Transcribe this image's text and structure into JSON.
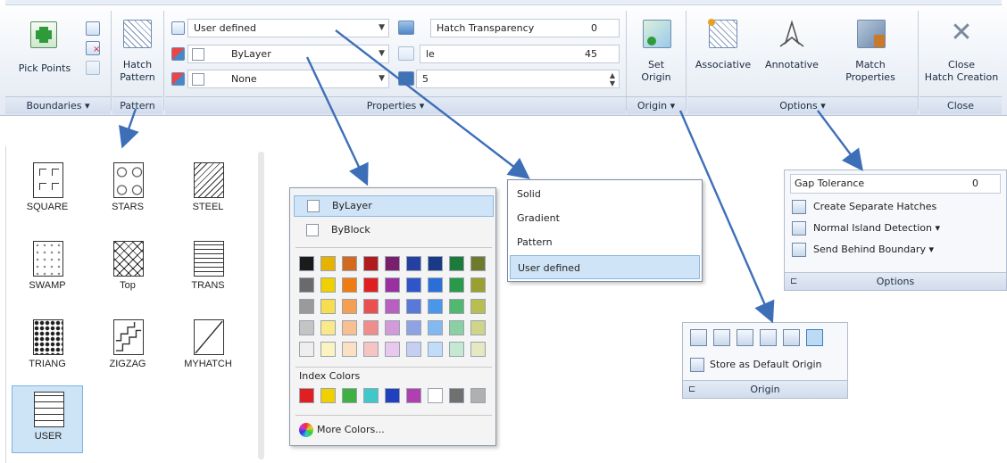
{
  "ribbon": {
    "boundaries": {
      "pick_points": "Pick Points",
      "panel_label": "Boundaries"
    },
    "pattern": {
      "button_line1": "Hatch",
      "button_line2": "Pattern",
      "panel_label": "Pattern"
    },
    "properties": {
      "hatch_type": "User defined",
      "color": "ByLayer",
      "background": "None",
      "transparency_label": "Hatch Transparency",
      "transparency_value": "0",
      "angle_label": "le",
      "angle_value": "45",
      "scale_value": "5",
      "panel_label": "Properties"
    },
    "origin": {
      "set_origin_line1": "Set",
      "set_origin_line2": "Origin",
      "panel_label": "Origin"
    },
    "options": {
      "associative": "Associative",
      "annotative": "Annotative",
      "match_line1": "Match",
      "match_line2": "Properties",
      "panel_label": "Options"
    },
    "close": {
      "line1": "Close",
      "line2": "Hatch Creation",
      "panel_label": "Close"
    }
  },
  "patterns": [
    {
      "name": "SQUARE"
    },
    {
      "name": "STARS"
    },
    {
      "name": "STEEL"
    },
    {
      "name": "SWAMP"
    },
    {
      "name": "Top"
    },
    {
      "name": "TRANS"
    },
    {
      "name": "TRIANG"
    },
    {
      "name": "ZIGZAG"
    },
    {
      "name": "MYHATCH"
    },
    {
      "name": "USER"
    }
  ],
  "color_menu": {
    "bylayer": "ByLayer",
    "byblock": "ByBlock",
    "index_colors_label": "Index Colors",
    "more_colors": "More Colors...",
    "grid_rows": [
      [
        "#1b1b1b",
        "#e6b400",
        "#d2691e",
        "#b01c1c",
        "#7a1f6b",
        "#2440a0",
        "#1a3a86",
        "#1e7a3a",
        "#707a2c"
      ],
      [
        "#6a6a6a",
        "#f0d000",
        "#ef7c10",
        "#e02020",
        "#9a2fa0",
        "#2f55c8",
        "#2a6ed8",
        "#2a9a4a",
        "#9aa030"
      ],
      [
        "#9a9a9a",
        "#f6de50",
        "#f4a050",
        "#ea5050",
        "#b860c0",
        "#5a78d8",
        "#4a96e8",
        "#52b870",
        "#b8be50"
      ],
      [
        "#c4c4c4",
        "#f9e98a",
        "#f8c090",
        "#f08c8c",
        "#d29ad8",
        "#8fa3e4",
        "#84b8f0",
        "#8ad0a0",
        "#d0d48a"
      ],
      [
        "#eeeeee",
        "#fcf3c0",
        "#fbe0c4",
        "#f7c4c4",
        "#e8c8ec",
        "#c4cff2",
        "#c0dcf8",
        "#c4e8d0",
        "#e6e8c2"
      ]
    ],
    "index_row": [
      "#e02020",
      "#f0d000",
      "#40b040",
      "#40c8c8",
      "#2040c0",
      "#b040b0",
      "#ffffff",
      "#707070",
      "#b0b0b0"
    ]
  },
  "type_menu": {
    "items": [
      "Solid",
      "Gradient",
      "Pattern",
      "User defined"
    ]
  },
  "options_panel": {
    "gap_label": "Gap Tolerance",
    "gap_value": "0",
    "separate": "Create Separate Hatches",
    "island": "Normal Island Detection",
    "send_behind": "Send Behind Boundary",
    "panel_label": "Options"
  },
  "origin_panel": {
    "store_default": "Store as Default Origin",
    "panel_label": "Origin"
  },
  "colors": {
    "callout_arrow": "#3d6fb8",
    "selection": "#cfe4f6"
  }
}
